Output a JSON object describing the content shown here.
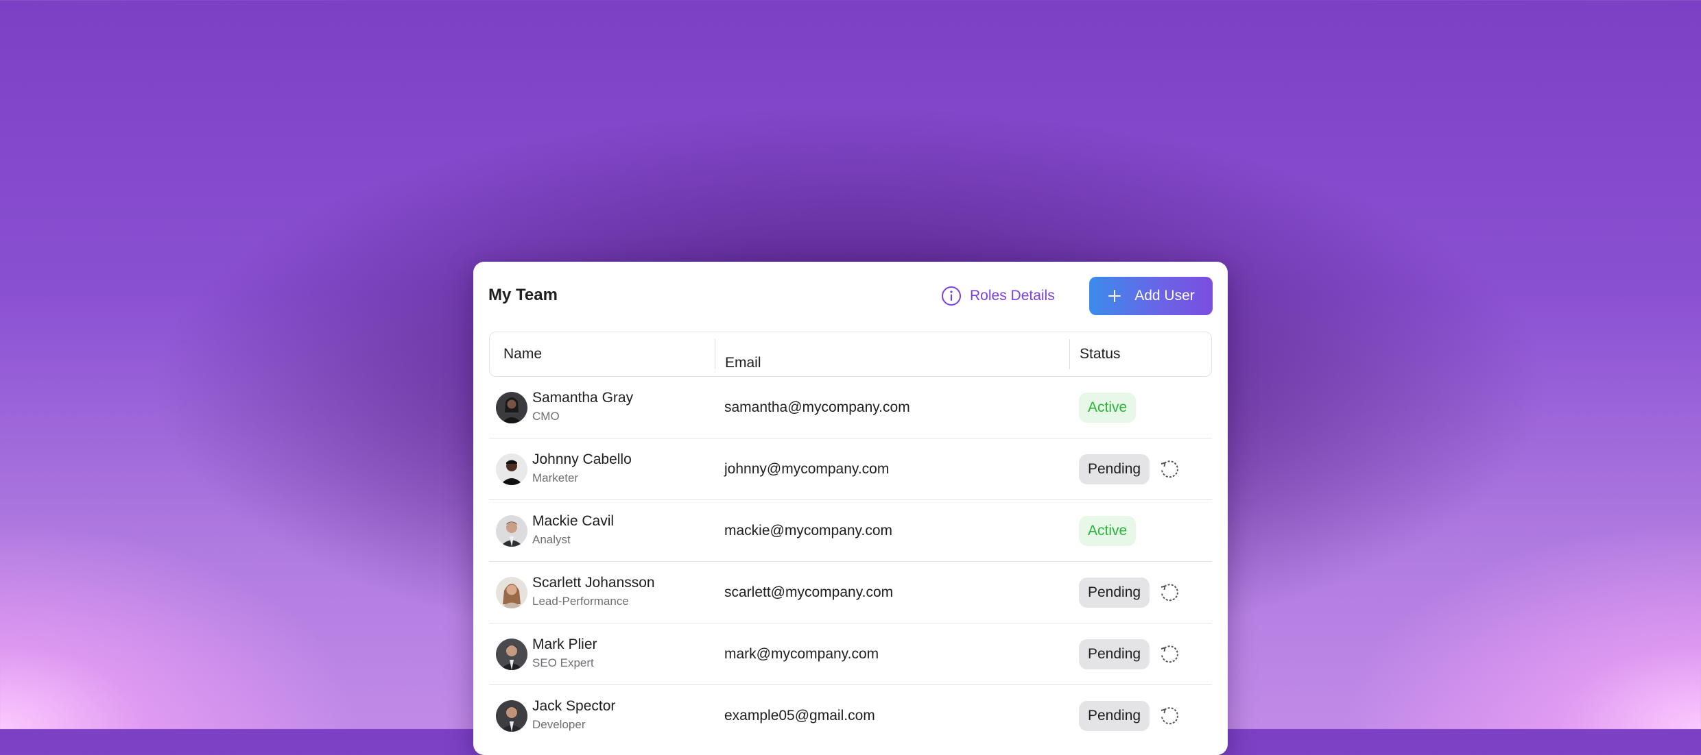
{
  "header": {
    "title": "My Team",
    "roles_label": "Roles Details",
    "add_label": "Add User"
  },
  "columns": [
    "Name",
    "Email",
    "Status"
  ],
  "members": [
    {
      "name": "Samantha Gray",
      "role": "CMO",
      "email": "samantha@mycompany.com",
      "status": "Active"
    },
    {
      "name": "Johnny Cabello",
      "role": "Marketer",
      "email": "johnny@mycompany.com",
      "status": "Pending"
    },
    {
      "name": "Mackie Cavil",
      "role": "Analyst",
      "email": "mackie@mycompany.com",
      "status": "Active"
    },
    {
      "name": "Scarlett Johansson",
      "role": "Lead-Performance",
      "email": "scarlett@mycompany.com",
      "status": "Pending"
    },
    {
      "name": "Mark Plier",
      "role": "SEO Expert",
      "email": "mark@mycompany.com",
      "status": "Pending"
    },
    {
      "name": "Jack Spector",
      "role": "Developer",
      "email": "example05@gmail.com",
      "status": "Pending"
    }
  ],
  "colors": {
    "accent": "#7b3fdc",
    "button_gradient_start": "#3b8ceb",
    "button_gradient_end": "#7a4ee0",
    "active_text": "#2bb33a",
    "active_bg": "#e7f8e8",
    "pending_bg": "#e4e4e6"
  },
  "icons": {
    "roles": "info-icon",
    "add": "plus-icon",
    "resend": "refresh-icon"
  }
}
